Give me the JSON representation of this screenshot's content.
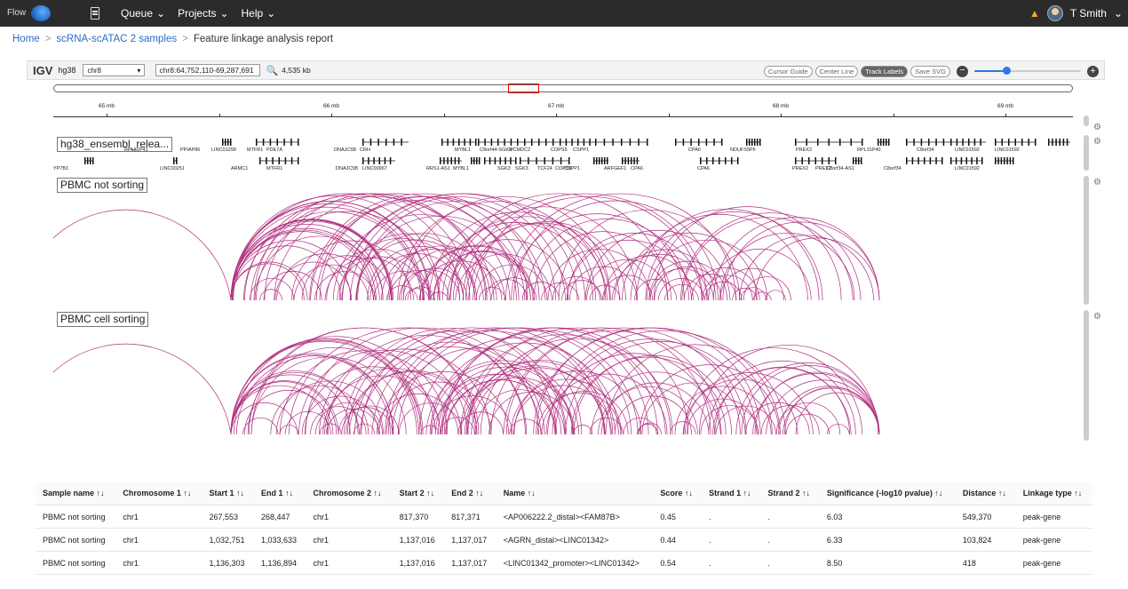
{
  "nav": {
    "logo_text": "Flow",
    "items": [
      {
        "label": "Queue",
        "caret": "⌄"
      },
      {
        "label": "Projects",
        "caret": "⌄"
      },
      {
        "label": "Help",
        "caret": "⌄"
      }
    ],
    "user": "T Smith",
    "user_caret": "⌄"
  },
  "breadcrumb": {
    "home": "Home",
    "sep": ">",
    "parent": "scRNA-scATAC 2 samples",
    "current": "Feature linkage analysis report"
  },
  "igv": {
    "logo": "IGV",
    "genome": "hg38",
    "chrom": "chr8",
    "locus": "chr8:64,752,110-69,287,691",
    "width": "4,535 kb",
    "buttons": [
      "Cursor Guide",
      "Center Line",
      "Track Labels",
      "Save SVG"
    ],
    "active_button": "Track Labels",
    "zoom_level": 0.3,
    "accent_color": "#2a7ae2",
    "arc_color": "#b0307f",
    "ruler_labels": [
      "65 mb",
      "66 mb",
      "67 mb",
      "68 mb",
      "69 mb"
    ],
    "gene_track_label": "hg38_ensembl_relea...",
    "gene_labels_row1": [
      "RPL31P41",
      "PPIAP86",
      "LINC01299",
      "MTFR1",
      "PDE7A",
      "DNAJC5B",
      "CRH",
      "MYBL1",
      "C8orf44-SGK3",
      "MCMDC2",
      "COPS5",
      "CSPP1",
      "CPA6",
      "NDUFS5P6",
      "PREX2",
      "RPL31P40",
      "C8orf34",
      "LINC01592",
      "LINC01592"
    ],
    "gene_labels_row2": [
      "YP7B1",
      "LINC00251",
      "ARMC1",
      "MTFR1",
      "DNAJC5B",
      "LINC00967",
      "RRS1-AS1",
      "MYBL1",
      "SGK3",
      "SGK3",
      "TCF24",
      "COPS5",
      "CSPP1",
      "ARFGEF1",
      "CPA6",
      "CPA6",
      "PREX2",
      "PREX2",
      "C8orf34-AS1",
      "C8orf34",
      "LINC01592"
    ],
    "tracks": [
      {
        "label": "PBMC not sorting"
      },
      {
        "label": "PBMC cell sorting"
      }
    ]
  },
  "table": {
    "headers": [
      "Sample name ↑↓",
      "Chromosome 1 ↑↓",
      "Start 1 ↑↓",
      "End 1 ↑↓",
      "Chromosome 2 ↑↓",
      "Start 2 ↑↓",
      "End 2 ↑↓",
      "Name ↑↓",
      "Score ↑↓",
      "Strand 1 ↑↓",
      "Strand 2 ↑↓",
      "Significance (-log10 pvalue) ↑↓",
      "Distance ↑↓",
      "Linkage type ↑↓"
    ],
    "rows": [
      [
        "PBMC not sorting",
        "chr1",
        "267,553",
        "268,447",
        "chr1",
        "817,370",
        "817,371",
        "<AP006222.2_distal><FAM87B>",
        "0.45",
        ".",
        ".",
        "6.03",
        "549,370",
        "peak-gene"
      ],
      [
        "PBMC not sorting",
        "chr1",
        "1,032,751",
        "1,033,633",
        "chr1",
        "1,137,016",
        "1,137,017",
        "<AGRN_distal><LINC01342>",
        "0.44",
        ".",
        ".",
        "6.33",
        "103,824",
        "peak-gene"
      ],
      [
        "PBMC not sorting",
        "chr1",
        "1,136,303",
        "1,136,894",
        "chr1",
        "1,137,016",
        "1,137,017",
        "<LINC01342_promoter><LINC01342>",
        "0.54",
        ".",
        ".",
        "8.50",
        "418",
        "peak-gene"
      ]
    ]
  }
}
